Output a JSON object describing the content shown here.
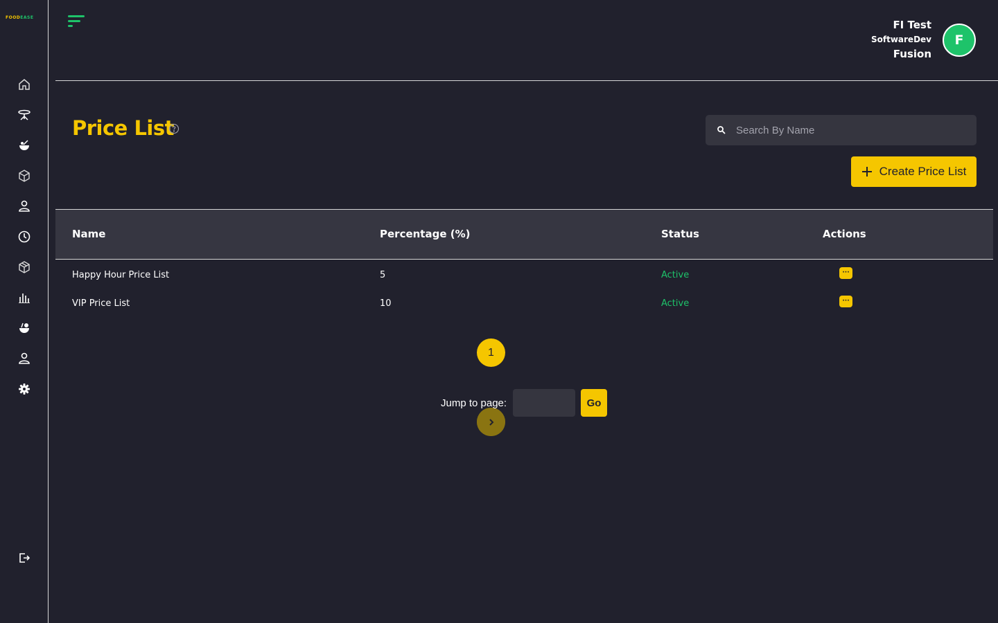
{
  "brand": {
    "logo_part1": "FOOD",
    "logo_part2": "EASE",
    "accent": "#f5c600",
    "green": "#1ec36a",
    "background": "#21212d"
  },
  "sidebar": {
    "items": [
      {
        "icon": "home-icon"
      },
      {
        "icon": "dining-table-icon"
      },
      {
        "icon": "food-bowl-icon"
      },
      {
        "icon": "box-icon"
      },
      {
        "icon": "user-icon"
      },
      {
        "icon": "clock-icon"
      },
      {
        "icon": "package-icon"
      },
      {
        "icon": "bar-chart-icon"
      },
      {
        "icon": "meal-icon"
      },
      {
        "icon": "staff-icon"
      },
      {
        "icon": "settings-gear-icon"
      }
    ],
    "logout_icon": "logout-icon"
  },
  "user": {
    "line1": "FI Test",
    "line2": "SoftwareDev",
    "line3": "Fusion",
    "avatar_letter": "F"
  },
  "page": {
    "title": "Price List"
  },
  "search": {
    "placeholder": "Search By Name",
    "value": ""
  },
  "create_button": {
    "label": "Create Price List"
  },
  "table": {
    "headers": {
      "name": "Name",
      "percentage": "Percentage (%)",
      "status": "Status",
      "actions": "Actions"
    },
    "rows": [
      {
        "name": "Happy Hour Price List",
        "percentage": "5",
        "status": "Active",
        "action": "···"
      },
      {
        "name": "VIP Price List",
        "percentage": "10",
        "status": "Active",
        "action": "···"
      }
    ]
  },
  "pagination": {
    "current_page": "1",
    "jump_label": "Jump to page:",
    "jump_value": "",
    "go_label": "Go"
  }
}
